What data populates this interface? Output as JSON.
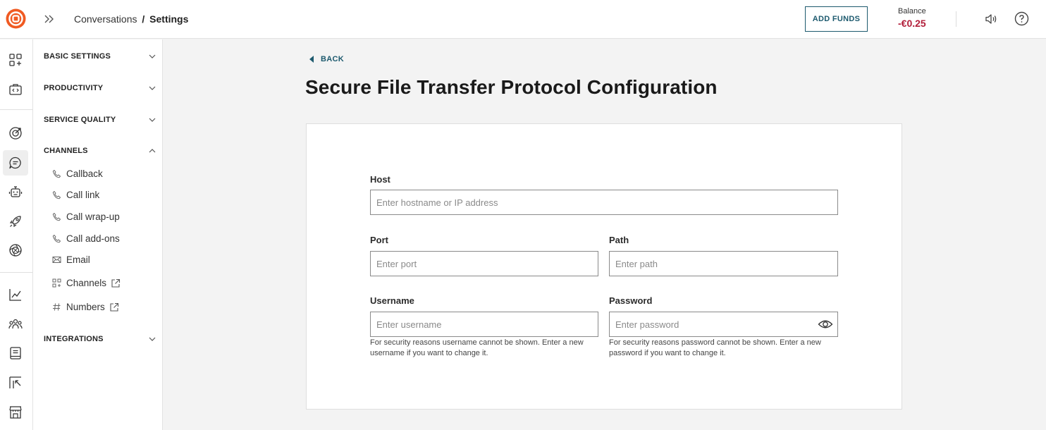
{
  "header": {
    "breadcrumb_parent": "Conversations",
    "breadcrumb_sep": "/",
    "breadcrumb_current": "Settings",
    "add_funds_label": "ADD FUNDS",
    "balance_label": "Balance",
    "balance_value": "-€0.25"
  },
  "rail": {
    "icons": [
      "apps-add-icon",
      "code-briefcase-icon",
      "target-icon",
      "chat-icon",
      "robot-icon",
      "rocket-icon",
      "ai-swirl-icon",
      "analytics-chart-icon",
      "people-icon",
      "book-icon",
      "export-icon",
      "store-icon"
    ],
    "active": "chat-icon"
  },
  "sidebar": {
    "sections": [
      {
        "label": "BASIC SETTINGS",
        "expanded": false
      },
      {
        "label": "PRODUCTIVITY",
        "expanded": false
      },
      {
        "label": "SERVICE QUALITY",
        "expanded": false
      },
      {
        "label": "CHANNELS",
        "expanded": true
      },
      {
        "label": "INTEGRATIONS",
        "expanded": false
      }
    ],
    "channel_items": [
      {
        "label": "Callback",
        "icon": "phone-icon"
      },
      {
        "label": "Call link",
        "icon": "phone-icon"
      },
      {
        "label": "Call wrap-up",
        "icon": "phone-icon"
      },
      {
        "label": "Call add-ons",
        "icon": "phone-icon"
      },
      {
        "label": "Email",
        "icon": "envelope-icon"
      },
      {
        "label": "Channels",
        "icon": "apps-add-icon",
        "external": true
      },
      {
        "label": "Numbers",
        "icon": "hash-icon",
        "external": true
      }
    ]
  },
  "main": {
    "back_label": "BACK",
    "title": "Secure File Transfer Protocol Configuration",
    "form": {
      "host": {
        "label": "Host",
        "placeholder": "Enter hostname or IP address",
        "value": ""
      },
      "port": {
        "label": "Port",
        "placeholder": "Enter port",
        "value": ""
      },
      "path": {
        "label": "Path",
        "placeholder": "Enter path",
        "value": ""
      },
      "username": {
        "label": "Username",
        "placeholder": "Enter username",
        "value": "",
        "help": "For security reasons username cannot be shown. Enter a new username if you want to change it."
      },
      "password": {
        "label": "Password",
        "placeholder": "Enter password",
        "value": "",
        "help": "For security reasons password cannot be shown. Enter a new password if you want to change it."
      }
    }
  },
  "colors": {
    "accent": "#1d5a6e",
    "brand": "#f05a22",
    "balance_negative": "#b21e3a"
  }
}
